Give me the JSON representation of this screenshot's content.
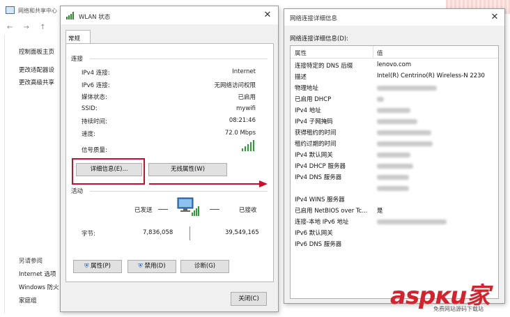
{
  "background_window": {
    "title": "网络和共享中心",
    "nav": "←  →  ↑",
    "links": [
      "控制面板主页",
      "更改适配器设",
      "更改高级共享"
    ],
    "see_also_header": "另请参阅",
    "see_also": [
      "Internet 选项",
      "Windows 防火",
      "家庭组"
    ]
  },
  "wlan_dialog": {
    "title": "WLAN 状态",
    "tab": "常规",
    "connection_group": "连接",
    "rows": [
      {
        "label": "IPv4 连接:",
        "value": "Internet"
      },
      {
        "label": "IPv6 连接:",
        "value": "无网络访问权限"
      },
      {
        "label": "媒体状态:",
        "value": "已启用"
      },
      {
        "label": "SSID:",
        "value": "mywifi"
      },
      {
        "label": "持续时间:",
        "value": "08:21:46"
      },
      {
        "label": "速度:",
        "value": "72.0 Mbps"
      }
    ],
    "signal_label": "信号质量:",
    "signal_bars": 5,
    "details_button": "详细信息(E)...",
    "wireless_props_button": "无线属性(W)",
    "activity_group": "活动",
    "sent_label": "已发送",
    "received_label": "已接收",
    "bytes_label": "字节:",
    "bytes_sent": "7,836,058",
    "bytes_received": "39,549,165",
    "properties_button": "属性(P)",
    "disable_button": "禁用(D)",
    "diagnose_button": "诊断(G)",
    "close_button": "关闭(C)"
  },
  "details_dialog": {
    "title": "网络连接详细信息",
    "caption": "网络连接详细信息(D):",
    "col_property": "属性",
    "col_value": "值",
    "rows": [
      {
        "property": "连接特定的 DNS 后缀",
        "value": "lenovo.com",
        "blurred": false
      },
      {
        "property": "描述",
        "value": "Intel(R) Centrino(R) Wireless-N 2230",
        "blurred": false
      },
      {
        "property": "物理地址",
        "value": "",
        "blurred": true
      },
      {
        "property": "已启用 DHCP",
        "value": "",
        "blurred": true
      },
      {
        "property": "IPv4 地址",
        "value": "",
        "blurred": true
      },
      {
        "property": "IPv4 子网掩码",
        "value": "",
        "blurred": true
      },
      {
        "property": "获得租约的时间",
        "value": "",
        "blurred": true
      },
      {
        "property": "租约过期的时间",
        "value": "",
        "blurred": true
      },
      {
        "property": "IPv4 默认网关",
        "value": "",
        "blurred": true
      },
      {
        "property": "IPv4 DHCP 服务器",
        "value": "",
        "blurred": true
      },
      {
        "property": "IPv4 DNS 服务器",
        "value": "",
        "blurred": true
      },
      {
        "property": "",
        "value": "",
        "blurred": true
      },
      {
        "property": "IPv4 WINS 服务器",
        "value": "",
        "blurred": false
      },
      {
        "property": "已启用 NetBIOS over Tc...",
        "value": "是",
        "blurred": false
      },
      {
        "property": "连接-本地 IPv6 地址",
        "value": "",
        "blurred": true
      },
      {
        "property": "IPv6 默认网关",
        "value": "",
        "blurred": false
      },
      {
        "property": "IPv6 DNS 服务器",
        "value": "",
        "blurred": false
      }
    ]
  },
  "watermark": {
    "text": "aspĸu家",
    "sub": "免费网站源码下载站"
  },
  "colors": {
    "highlight": "#c8102e",
    "signal": "#27a12f",
    "button_bg": "#e1e1e1"
  }
}
